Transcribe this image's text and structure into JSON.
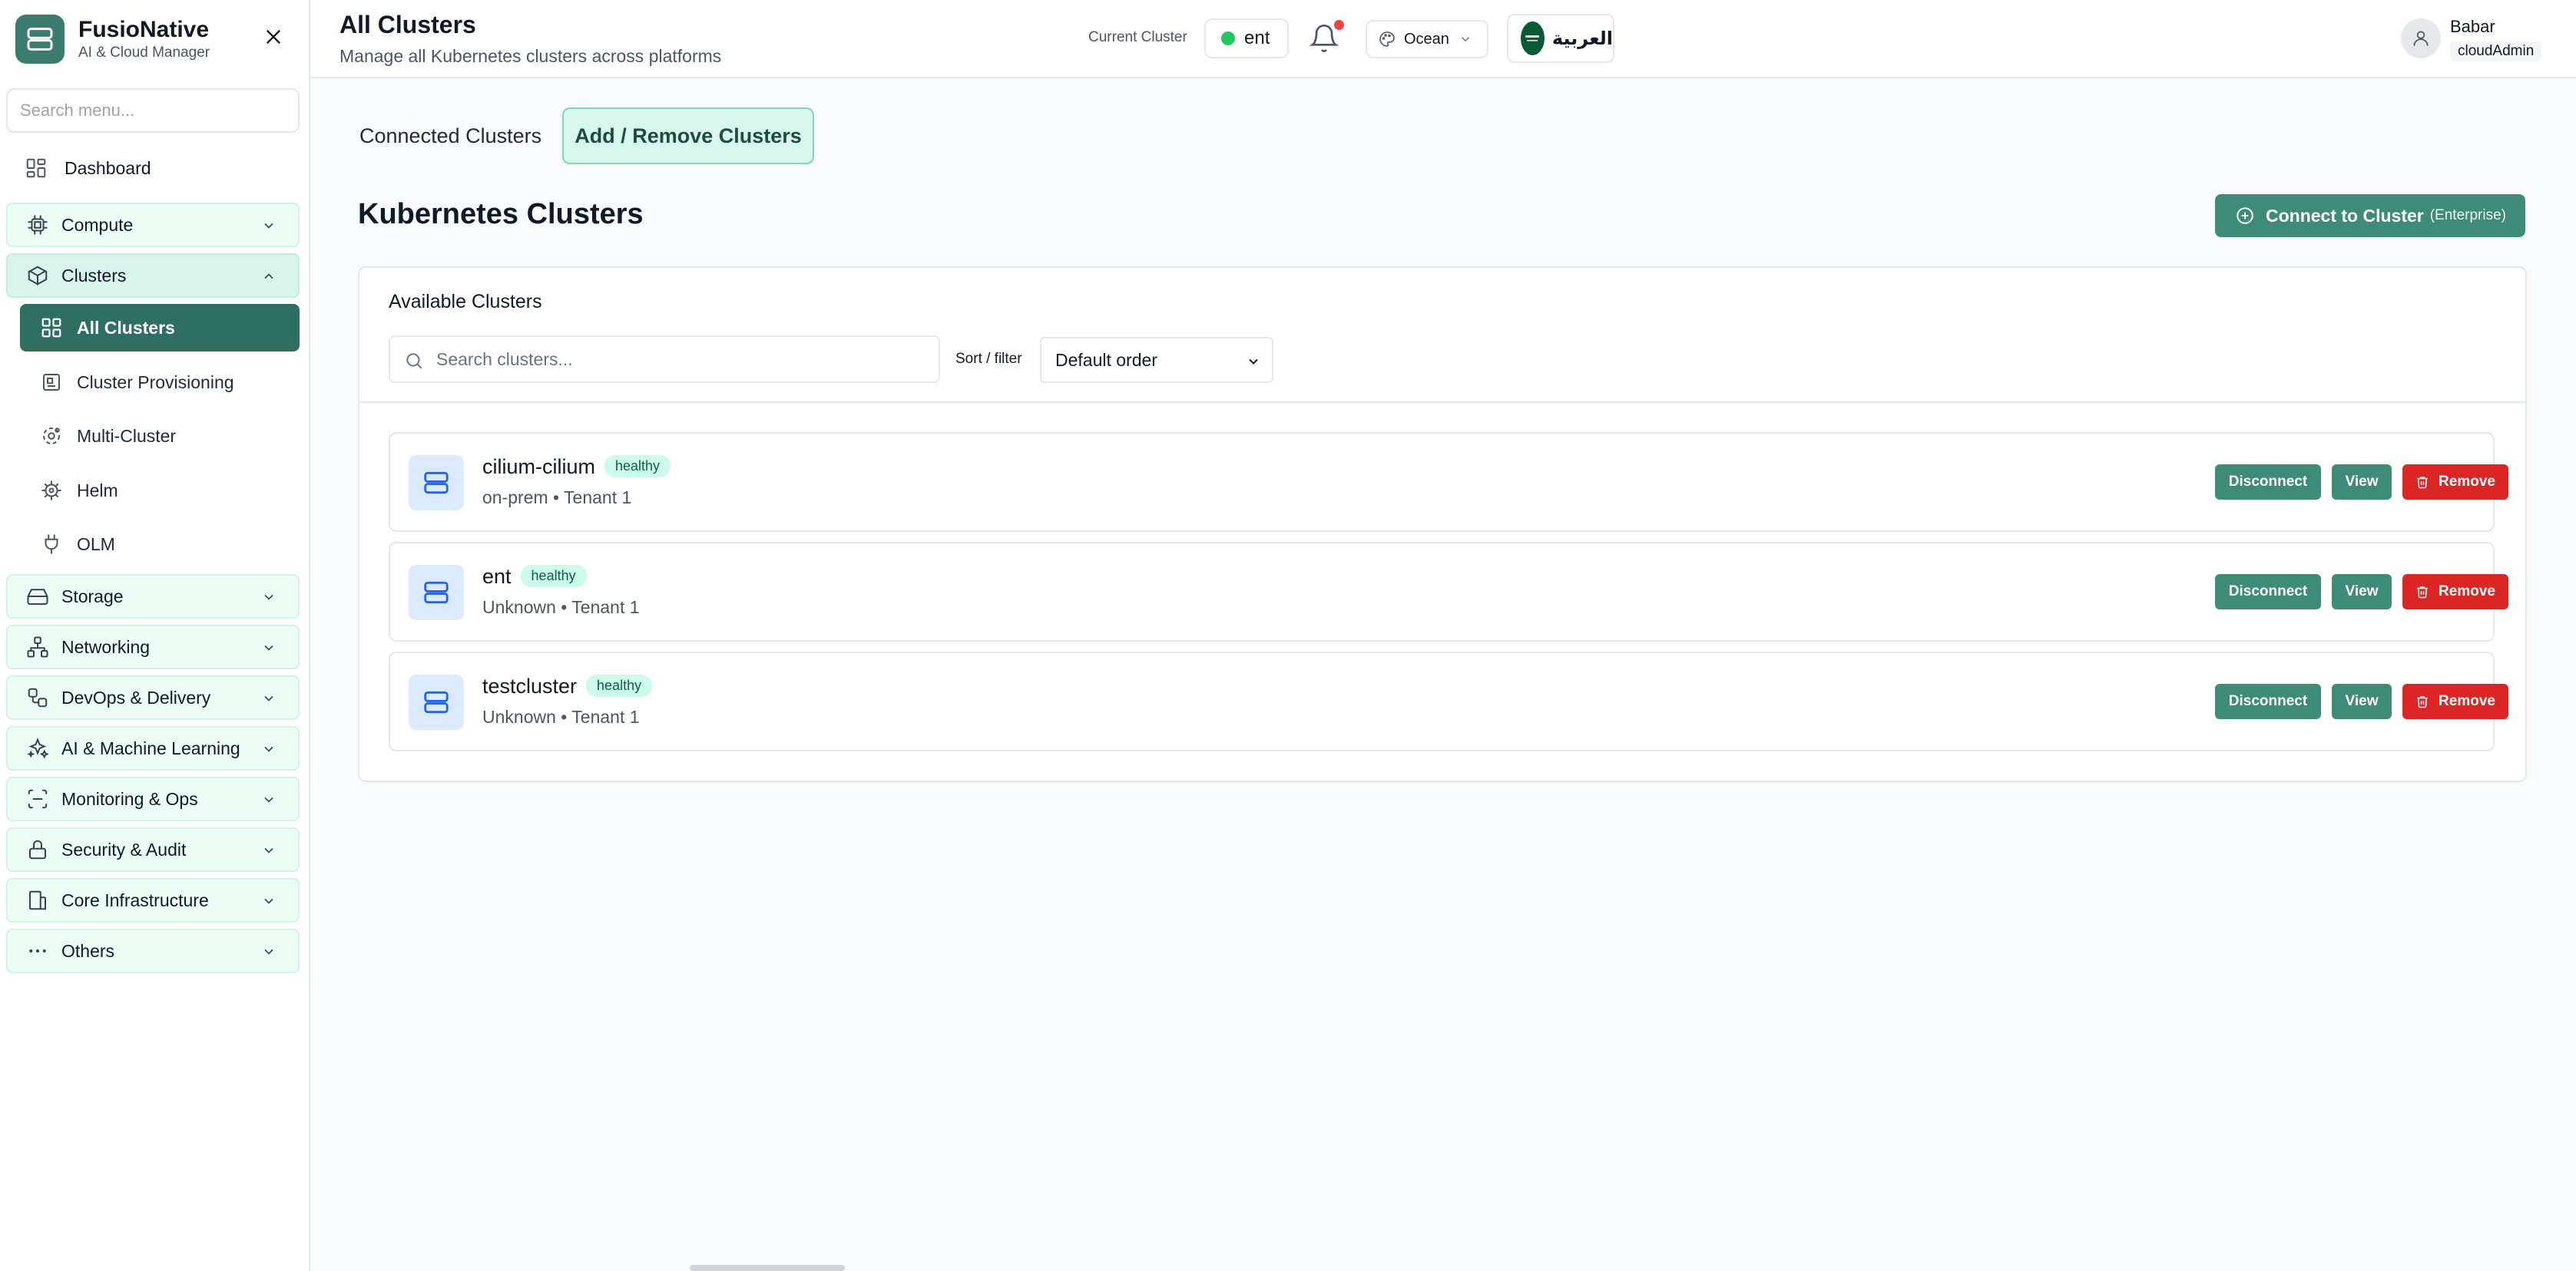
{
  "brand": {
    "title": "FusioNative",
    "subtitle": "AI & Cloud Manager"
  },
  "sidebar": {
    "search_placeholder": "Search menu...",
    "dashboard": "Dashboard",
    "groups": {
      "compute": "Compute",
      "clusters": "Clusters",
      "storage": "Storage",
      "networking": "Networking",
      "devops": "DevOps & Delivery",
      "ai": "AI & Machine Learning",
      "monitoring": "Monitoring & Ops",
      "security": "Security & Audit",
      "core": "Core Infrastructure",
      "others": "Others"
    },
    "cluster_items": {
      "all": "All Clusters",
      "provisioning": "Cluster Provisioning",
      "multi": "Multi-Cluster",
      "helm": "Helm",
      "olm": "OLM"
    }
  },
  "header": {
    "title": "All Clusters",
    "subtitle": "Manage all Kubernetes clusters across platforms",
    "current_cluster_label": "Current Cluster",
    "current_cluster_value": "ent",
    "theme": "Ocean",
    "language": "العربية",
    "user_name": "Babar",
    "user_role": "cloudAdmin"
  },
  "tabs": {
    "connected": "Connected Clusters",
    "add_remove": "Add / Remove Clusters"
  },
  "main": {
    "section_title": "Kubernetes Clusters",
    "connect_label": "Connect to Cluster",
    "connect_suffix": "(Enterprise)",
    "card_title": "Available Clusters",
    "search_placeholder": "Search clusters...",
    "sort_label": "Sort / filter",
    "sort_value": "Default order",
    "actions": {
      "disconnect": "Disconnect",
      "view": "View",
      "remove": "Remove"
    },
    "clusters": [
      {
        "name": "cilium-cilium",
        "status": "healthy",
        "meta": "on-prem • Tenant 1"
      },
      {
        "name": "ent",
        "status": "healthy",
        "meta": "Unknown • Tenant 1"
      },
      {
        "name": "testcluster",
        "status": "healthy",
        "meta": "Unknown • Tenant 1"
      }
    ]
  },
  "colors": {
    "accent": "#3e8c78",
    "active_nav": "#2f6f62",
    "danger": "#dc2626",
    "healthy_badge": "#ccfbea"
  }
}
